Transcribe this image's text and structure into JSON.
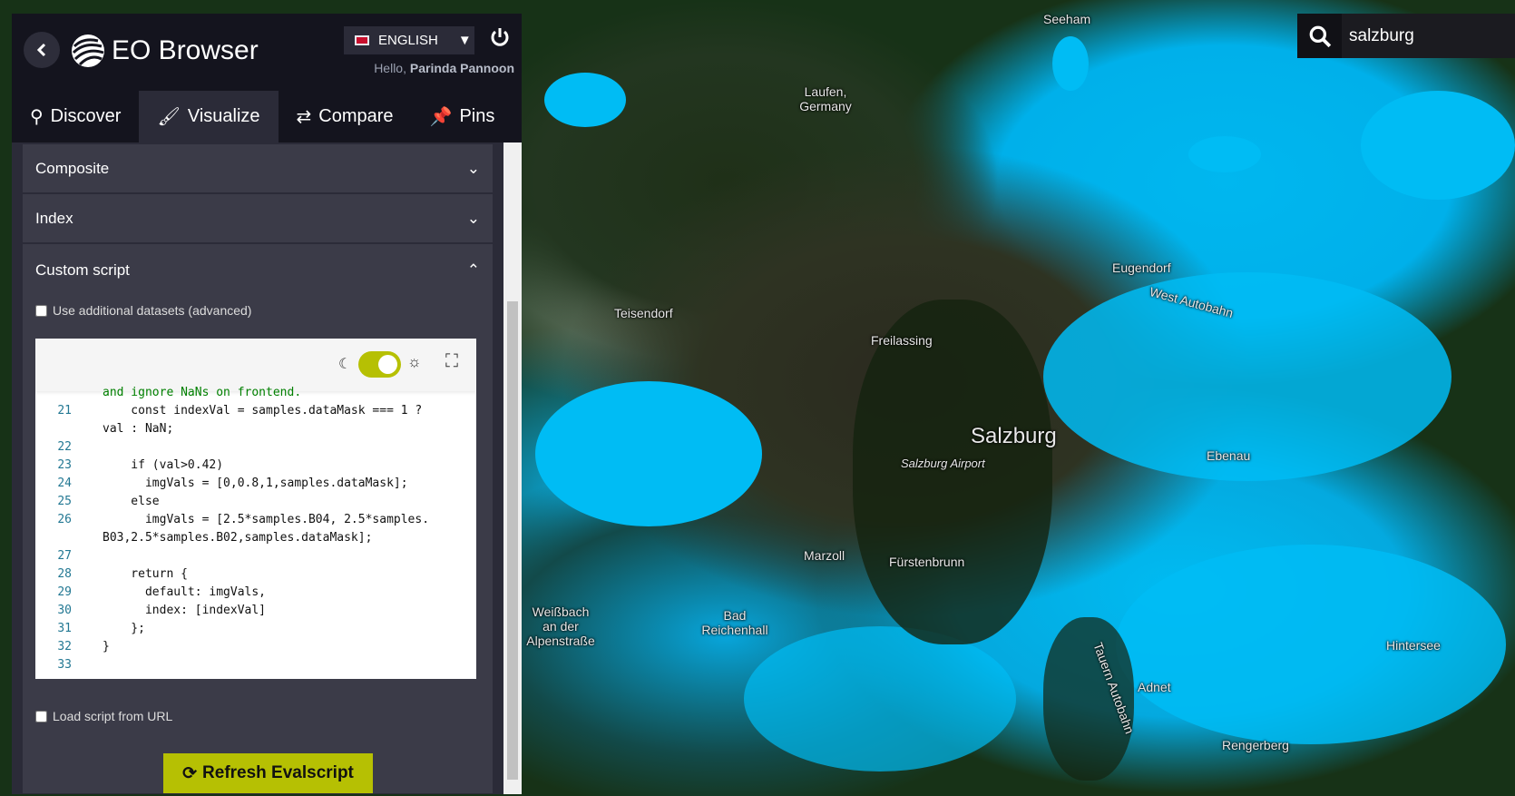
{
  "app": {
    "title": "EO Browser",
    "greeting": "Hello,",
    "user": "Parinda Pannoon",
    "language": "ENGLISH"
  },
  "tabs": [
    {
      "label": "Discover",
      "icon": "search-icon"
    },
    {
      "label": "Visualize",
      "icon": "brush-icon"
    },
    {
      "label": "Compare",
      "icon": "swap-icon"
    },
    {
      "label": "Pins",
      "icon": "pin-icon"
    }
  ],
  "active_tab": "Visualize",
  "accordion": {
    "composite": "Composite",
    "index": "Index",
    "custom": "Custom script"
  },
  "custom_script": {
    "use_datasets": "Use additional datasets (advanced)",
    "load_url": "Load script from URL",
    "refresh": "Refresh Evalscript",
    "theme_toggle_on": true
  },
  "code": {
    "wrap_line": "and ignore NaNs on frontend.",
    "lines": [
      {
        "n": "21",
        "t": "    const indexVal = samples.dataMask === 1 ?"
      },
      {
        "n": "",
        "t": "val : NaN;"
      },
      {
        "n": "22",
        "t": ""
      },
      {
        "n": "23",
        "t": "    if (val>0.42)"
      },
      {
        "n": "24",
        "t": "      imgVals = [0,0.8,1,samples.dataMask];"
      },
      {
        "n": "25",
        "t": "    else"
      },
      {
        "n": "26",
        "t": "      imgVals = [2.5*samples.B04, 2.5*samples."
      },
      {
        "n": "",
        "t": "B03,2.5*samples.B02,samples.dataMask];"
      },
      {
        "n": "27",
        "t": ""
      },
      {
        "n": "28",
        "t": "    return {"
      },
      {
        "n": "29",
        "t": "      default: imgVals,"
      },
      {
        "n": "30",
        "t": "      index: [indexVal]"
      },
      {
        "n": "31",
        "t": "    };"
      },
      {
        "n": "32",
        "t": "}"
      },
      {
        "n": "33",
        "t": ""
      }
    ]
  },
  "search": {
    "value": "salzburg"
  },
  "map_labels": [
    "Seeham",
    "Laufen, Germany",
    "Teisendorf",
    "Freilassing",
    "Eugendorf",
    "West Autobahn",
    "Salzburg",
    "Salzburg Airport",
    "Ebenau",
    "Marzoll",
    "Fürstenbrunn",
    "Weißbach an der Alpenstraße",
    "Bad Reichenhall",
    "Hintersee",
    "Adnet",
    "Tauern Autobahn",
    "Rengerberg"
  ],
  "colors": {
    "accent": "#b6c003",
    "water_highlight": "#00bcf4",
    "panel": "#14141e"
  }
}
